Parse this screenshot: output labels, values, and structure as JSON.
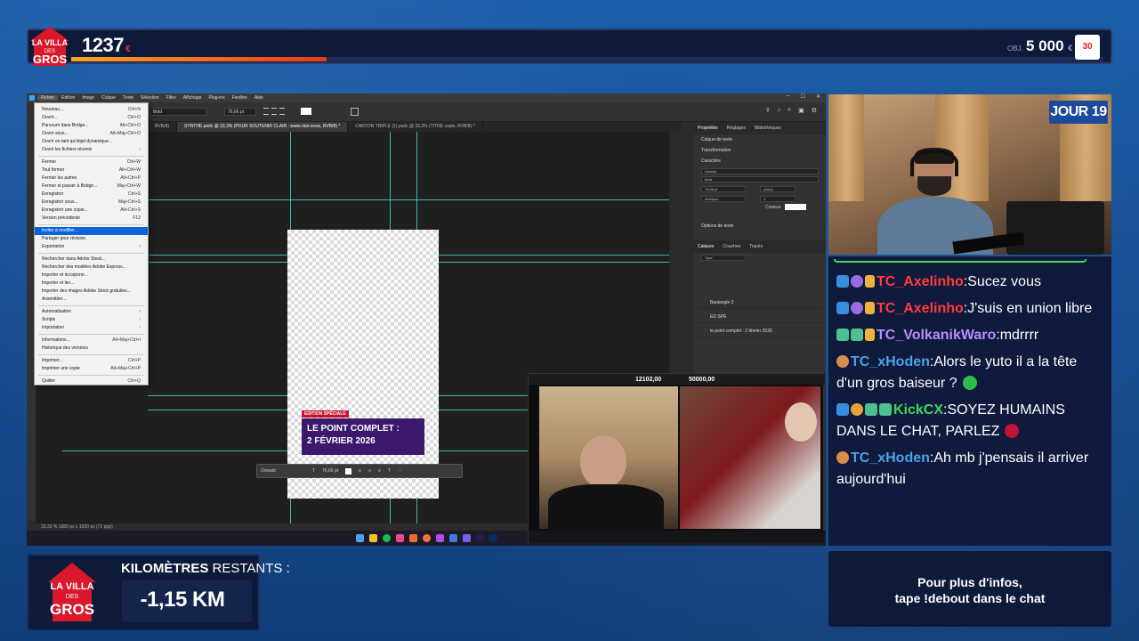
{
  "top_bar": {
    "amount": "1237",
    "currency": "€",
    "progress_fraction": 0.247,
    "goal_label": "OBJ.",
    "goal_amount": "5 000",
    "goal_currency": "€",
    "goal_badge": "30"
  },
  "logo": {
    "line1": "LA VILLA",
    "line2": "DES",
    "line3": "GROS"
  },
  "photoshop": {
    "menu": [
      "Fichier",
      "Edition",
      "Image",
      "Calque",
      "Texte",
      "Sélection",
      "Filtre",
      "Affichage",
      "Plug-ins",
      "Fenêtre",
      "Aide"
    ],
    "font_name": "Bold",
    "font_size": "76,66 pt",
    "tabs": [
      "RVB/8)",
      "SYNTHE.psdc @ 33,3% (POUR SOUTENIR CLAIR : www.clair.news, RVB/8) *",
      "CARTON TRIPLE (1).psdc @ 33,3% (TITRE copie, RVB/8) *"
    ],
    "file_menu": [
      {
        "label": "Nouveau...",
        "shortcut": "Ctrl+N"
      },
      {
        "label": "Ouvrir...",
        "shortcut": "Ctrl+O"
      },
      {
        "label": "Parcourir dans Bridge...",
        "shortcut": "Alt+Ctrl+O"
      },
      {
        "label": "Ouvrir sous...",
        "shortcut": "Alt+Maj+Ctrl+O"
      },
      {
        "label": "Ouvrir en tant qu'objet dynamique...",
        "shortcut": ""
      },
      {
        "label": "Ouvrir les fichiers récents",
        "shortcut": "›"
      },
      {
        "sep": true
      },
      {
        "label": "Fermer",
        "shortcut": "Ctrl+W"
      },
      {
        "label": "Tout fermer",
        "shortcut": "Alt+Ctrl+W"
      },
      {
        "label": "Fermer les autres",
        "shortcut": "Alt+Ctrl+P"
      },
      {
        "label": "Fermer et passer à Bridge...",
        "shortcut": "Maj+Ctrl+W"
      },
      {
        "label": "Enregistrer",
        "shortcut": "Ctrl+S"
      },
      {
        "label": "Enregistrer sous...",
        "shortcut": "Maj+Ctrl+S"
      },
      {
        "label": "Enregistrer une copie...",
        "shortcut": "Alt+Ctrl+S"
      },
      {
        "label": "Version précédente",
        "shortcut": "F12"
      },
      {
        "sep": true
      },
      {
        "label": "Inviter à modifier...",
        "shortcut": "",
        "highlight": true
      },
      {
        "label": "Partager pour révision",
        "shortcut": ""
      },
      {
        "label": "Exportation",
        "shortcut": "›"
      },
      {
        "sep": true
      },
      {
        "label": "Rechercher dans Adobe Stock...",
        "shortcut": ""
      },
      {
        "label": "Rechercher des modèles Adobe Express...",
        "shortcut": ""
      },
      {
        "label": "Importer et incorporer...",
        "shortcut": ""
      },
      {
        "label": "Importer et lier...",
        "shortcut": ""
      },
      {
        "label": "Importer des images Adobe Stock gratuites...",
        "shortcut": ""
      },
      {
        "label": "Assembler...",
        "shortcut": ""
      },
      {
        "sep": true
      },
      {
        "label": "Automatisation",
        "shortcut": "›"
      },
      {
        "label": "Scripts",
        "shortcut": "›"
      },
      {
        "label": "Importation",
        "shortcut": "›"
      },
      {
        "sep": true
      },
      {
        "label": "Informations...",
        "shortcut": "Alt+Maj+Ctrl+I"
      },
      {
        "label": "Historique des versions",
        "shortcut": ""
      },
      {
        "sep": true
      },
      {
        "label": "Imprimer...",
        "shortcut": "Ctrl+P"
      },
      {
        "label": "Imprimer une copie",
        "shortcut": "Alt+Maj+Ctrl+P"
      },
      {
        "sep": true
      },
      {
        "label": "Quitter",
        "shortcut": "Ctrl+Q"
      }
    ],
    "edition_tag": "EDITION SPÉCIALE",
    "headline_line1": "LE POINT COMPLET :",
    "headline_line2": "2 FÉVRIER 2026",
    "float_font": "Oswald",
    "float_size": "76,66 pt",
    "status": "33,33 %     1080 px x 1920 px (72 ppp)",
    "right_panel": {
      "tabs": [
        "Propriétés",
        "Réglages",
        "Bibliothèques"
      ],
      "layer_type": "Calque de texte",
      "transformation": "Transformation",
      "character": "Caractère",
      "font": "Oswald",
      "style": "Bold",
      "size": "76,66 pt",
      "leading": "(Auto)",
      "kerning": "Métrique",
      "tracking": "0",
      "color_label": "Couleur",
      "font_options": "Options de texte",
      "layer_tabs": [
        "Calques",
        "Couches",
        "Tracés"
      ],
      "kind": "Type",
      "layers": [
        "Bastangle 2",
        "ED SPÉ",
        "le point complet : 2 février 2026"
      ]
    }
  },
  "pip": {
    "amount": "12102,00",
    "goal": "50000,00"
  },
  "webcam": {
    "day_badge": "JOUR 19"
  },
  "chat": {
    "messages": [
      {
        "user": "TC_Axelinho",
        "color": "red",
        "badges": [
          "blue",
          "purple",
          "gift"
        ],
        "text": "Sucez vous"
      },
      {
        "user": "TC_Axelinho",
        "color": "red",
        "badges": [
          "blue",
          "purple",
          "gift"
        ],
        "text": "J'suis en union libre"
      },
      {
        "user": "TC_VolkanikWaro",
        "color": "purple",
        "badges": [
          "green",
          "green",
          "gift"
        ],
        "text": "mdrrrr"
      },
      {
        "user": "TC_xHoden",
        "color": "blue",
        "badges": [
          "orange"
        ],
        "text": "Alors le yuto il a la tête d'un gros baiseur ?"
      },
      {
        "user": "KickCX",
        "color": "green",
        "badges": [
          "blue",
          "gold",
          "green",
          "green"
        ],
        "text": "SOYEZ HUMAINS DANS LE CHAT, PARLEZ"
      },
      {
        "user": "TC_xHoden",
        "color": "blue",
        "badges": [
          "orange"
        ],
        "text": "Ah mb j'pensais il arriver aujourd'hui"
      }
    ]
  },
  "km_box": {
    "title_bold": "KILOMÈTRES",
    "title_rest": " RESTANTS :",
    "value": "-1,15 KM"
  },
  "info_box": {
    "line1": "Pour plus d'infos,",
    "line2": "tape !debout dans le chat"
  },
  "colors": {
    "accent_blue": "#1b5faa",
    "panel_dark": "#0e1a3a",
    "guide_cyan": "#3ee0d0",
    "headline_purple": "#3b1a6e",
    "tag_red": "#c8102e"
  }
}
